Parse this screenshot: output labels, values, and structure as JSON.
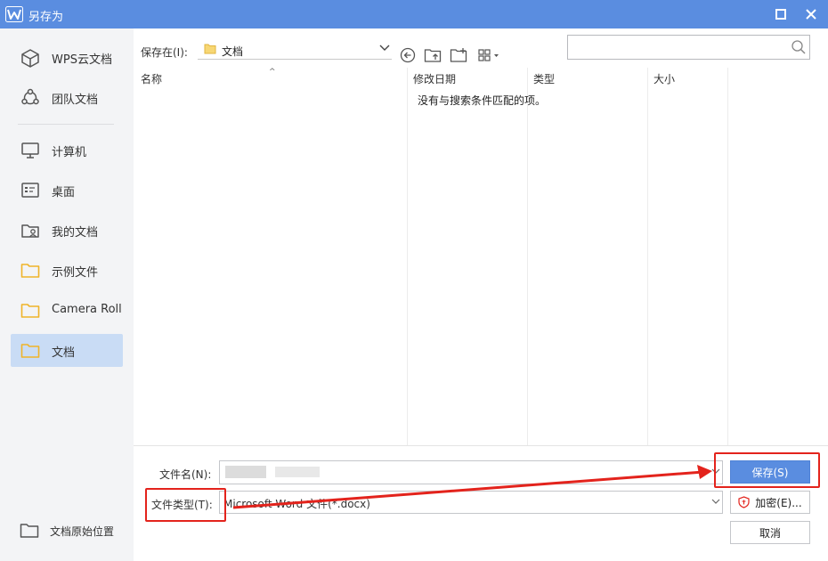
{
  "window": {
    "title": "另存为",
    "accent": "#5a8de0"
  },
  "sidebar": {
    "items": [
      {
        "label": "WPS云文档",
        "icon": "cube-icon"
      },
      {
        "label": "团队文档",
        "icon": "team-icon"
      },
      {
        "label": "计算机",
        "icon": "monitor-icon"
      },
      {
        "label": "桌面",
        "icon": "desktop-icon"
      },
      {
        "label": "我的文档",
        "icon": "user-folder-icon"
      },
      {
        "label": "示例文件",
        "icon": "folder-icon"
      },
      {
        "label": "Camera Roll",
        "icon": "folder-icon"
      },
      {
        "label": "文档",
        "icon": "folder-icon",
        "active": true
      }
    ],
    "original_location": "文档原始位置"
  },
  "toolbar": {
    "save_in_label": "保存在(I):",
    "current_folder": "文档",
    "search_placeholder": ""
  },
  "file_list": {
    "columns": [
      "名称",
      "修改日期",
      "类型",
      "大小"
    ],
    "empty_message": "没有与搜索条件匹配的项。"
  },
  "form": {
    "filename_label": "文件名(N):",
    "filetype_label": "文件类型(T):",
    "filetype_value": "Microsoft Word 文件(*.docx)",
    "save_label": "保存(S)",
    "encrypt_label": "加密(E)...",
    "cancel_label": "取消"
  },
  "annotation_color": "#e3231c"
}
